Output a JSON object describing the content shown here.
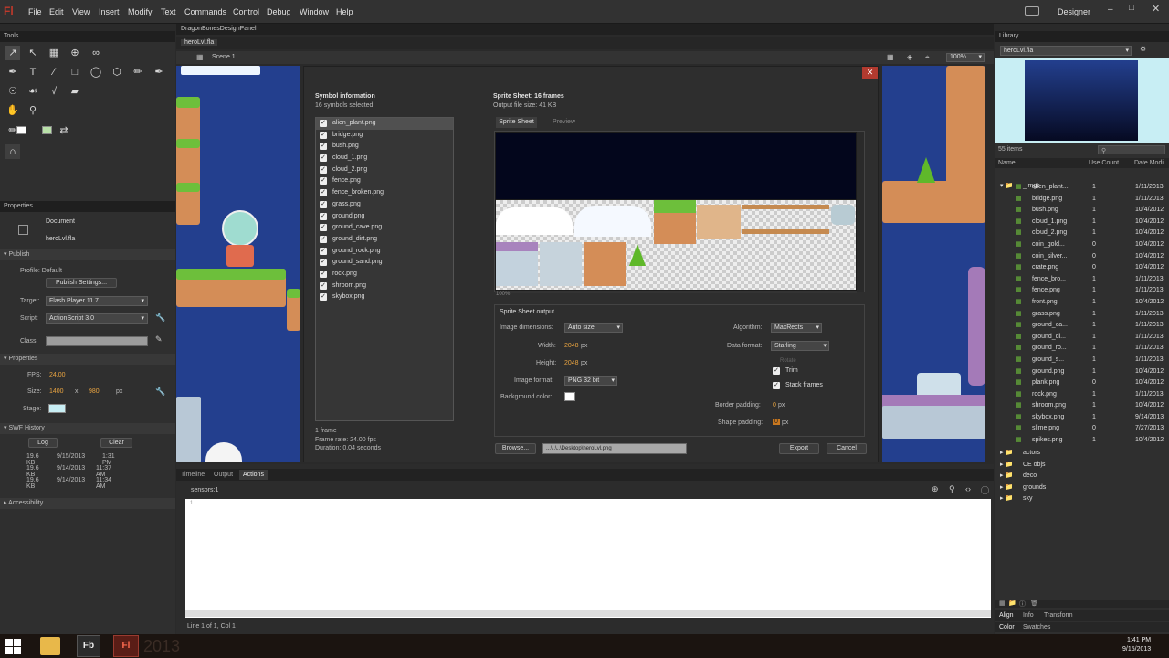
{
  "app": {
    "logo": "Fl",
    "workspace": "Designer"
  },
  "menu": [
    "File",
    "Edit",
    "View",
    "Insert",
    "Modify",
    "Text",
    "Commands",
    "Control",
    "Debug",
    "Window",
    "Help"
  ],
  "tools_panel": {
    "title": "Tools"
  },
  "doc": {
    "panel_tab": "DragonBonesDesignPanel",
    "file_tab": "heroLvl.fla",
    "scene": "Scene 1",
    "zoom": "100%"
  },
  "properties": {
    "title": "Properties",
    "doc_label": "Document",
    "doc_name": "heroLvl.fla",
    "publish_header": "Publish",
    "profile": "Profile: Default",
    "publish_settings": "Publish Settings...",
    "target_label": "Target:",
    "target_value": "Flash Player 11.7",
    "script_label": "Script:",
    "script_value": "ActionScript 3.0",
    "class_label": "Class:",
    "props_header": "Properties",
    "fps_label": "FPS:",
    "fps_value": "24.00",
    "size_label": "Size:",
    "size_w": "1400",
    "size_x": "x",
    "size_h": "980",
    "size_unit": "px",
    "stage_label": "Stage:",
    "swf_header": "SWF History",
    "log_btn": "Log",
    "clear_btn": "Clear",
    "history": [
      {
        "size": "19.6 KB",
        "date": "9/15/2013",
        "time": "1:31 PM"
      },
      {
        "size": "19.6 KB",
        "date": "9/14/2013",
        "time": "11:37 AM"
      },
      {
        "size": "19.6 KB",
        "date": "9/14/2013",
        "time": "11:34 AM"
      }
    ],
    "accessibility": "Accessibility"
  },
  "dialog": {
    "symbol_info": "Symbol information",
    "symbols_selected": "16 symbols selected",
    "symbols": [
      "alien_plant.png",
      "bridge.png",
      "bush.png",
      "cloud_1.png",
      "cloud_2.png",
      "fence.png",
      "fence_broken.png",
      "grass.png",
      "ground.png",
      "ground_cave.png",
      "ground_dirt.png",
      "ground_rock.png",
      "ground_sand.png",
      "rock.png",
      "shroom.png",
      "skybox.png"
    ],
    "frame_count": "1 frame",
    "frame_rate": "Frame rate: 24.00 fps",
    "duration": "Duration: 0.04 seconds",
    "sheet_title": "Sprite Sheet: 16 frames",
    "output_size": "Output file size: 41 KB",
    "tab_sheet": "Sprite Sheet",
    "tab_preview": "Preview",
    "zoom": "100%",
    "output_header": "Sprite Sheet output",
    "img_dim_label": "Image dimensions:",
    "img_dim_value": "Auto size",
    "width_label": "Width:",
    "width_value": "2048",
    "height_label": "Height:",
    "height_value": "2048",
    "px": "px",
    "img_format_label": "Image format:",
    "img_format_value": "PNG 32 bit",
    "bg_color_label": "Background color:",
    "algorithm_label": "Algorithm:",
    "algorithm_value": "MaxRects",
    "data_format_label": "Data format:",
    "data_format_value": "Starling",
    "rotate": "Rotate",
    "trim": "Trim",
    "stack": "Stack frames",
    "border_pad_label": "Border padding:",
    "border_pad_value": "0",
    "shape_pad_label": "Shape padding:",
    "shape_pad_value": "0",
    "browse": "Browse...",
    "path": "...\\..\\..\\Desktop\\heroLvl.png",
    "export": "Export",
    "cancel": "Cancel"
  },
  "bottom": {
    "tabs": [
      "Timeline",
      "Output",
      "Actions"
    ],
    "crumb": "sensors:1",
    "line_no": "1",
    "status": "Line 1 of 1, Col 1"
  },
  "library": {
    "title": "Library",
    "file": "heroLvl.fla",
    "count": "55 items",
    "cols": [
      "Name",
      "Use Count",
      "Date Modi"
    ],
    "folder": "_imgs",
    "items": [
      {
        "name": "alien_plant...",
        "count": "1",
        "date": "1/11/2013"
      },
      {
        "name": "bridge.png",
        "count": "1",
        "date": "1/11/2013"
      },
      {
        "name": "bush.png",
        "count": "1",
        "date": "10/4/2012"
      },
      {
        "name": "cloud_1.png",
        "count": "1",
        "date": "10/4/2012"
      },
      {
        "name": "cloud_2.png",
        "count": "1",
        "date": "10/4/2012"
      },
      {
        "name": "coin_gold...",
        "count": "0",
        "date": "10/4/2012"
      },
      {
        "name": "coin_silver...",
        "count": "0",
        "date": "10/4/2012"
      },
      {
        "name": "crate.png",
        "count": "0",
        "date": "10/4/2012"
      },
      {
        "name": "fence_bro...",
        "count": "1",
        "date": "1/11/2013"
      },
      {
        "name": "fence.png",
        "count": "1",
        "date": "1/11/2013"
      },
      {
        "name": "front.png",
        "count": "1",
        "date": "10/4/2012"
      },
      {
        "name": "grass.png",
        "count": "1",
        "date": "1/11/2013"
      },
      {
        "name": "ground_ca...",
        "count": "1",
        "date": "1/11/2013"
      },
      {
        "name": "ground_di...",
        "count": "1",
        "date": "1/11/2013"
      },
      {
        "name": "ground_ro...",
        "count": "1",
        "date": "1/11/2013"
      },
      {
        "name": "ground_s...",
        "count": "1",
        "date": "1/11/2013"
      },
      {
        "name": "ground.png",
        "count": "1",
        "date": "10/4/2012"
      },
      {
        "name": "plank.png",
        "count": "0",
        "date": "10/4/2012"
      },
      {
        "name": "rock.png",
        "count": "1",
        "date": "1/11/2013"
      },
      {
        "name": "shroom.png",
        "count": "1",
        "date": "10/4/2012"
      },
      {
        "name": "skybox.png",
        "count": "1",
        "date": "9/14/2013"
      },
      {
        "name": "slime.png",
        "count": "0",
        "date": "7/27/2013"
      },
      {
        "name": "spikes.png",
        "count": "1",
        "date": "10/4/2012"
      }
    ],
    "folders": [
      "actors",
      "CE objs",
      "deco",
      "grounds",
      "sky"
    ],
    "tabs": [
      "Align",
      "Info",
      "Transform"
    ],
    "tabs2": [
      "Color",
      "Swatches"
    ]
  },
  "taskbar": {
    "time": "1:41 PM",
    "date": "9/15/2013",
    "year_ghost": "2013"
  },
  "colors": {
    "accent": "#e8a340",
    "stage": "#233f8e",
    "flash_red": "#c0392b"
  }
}
